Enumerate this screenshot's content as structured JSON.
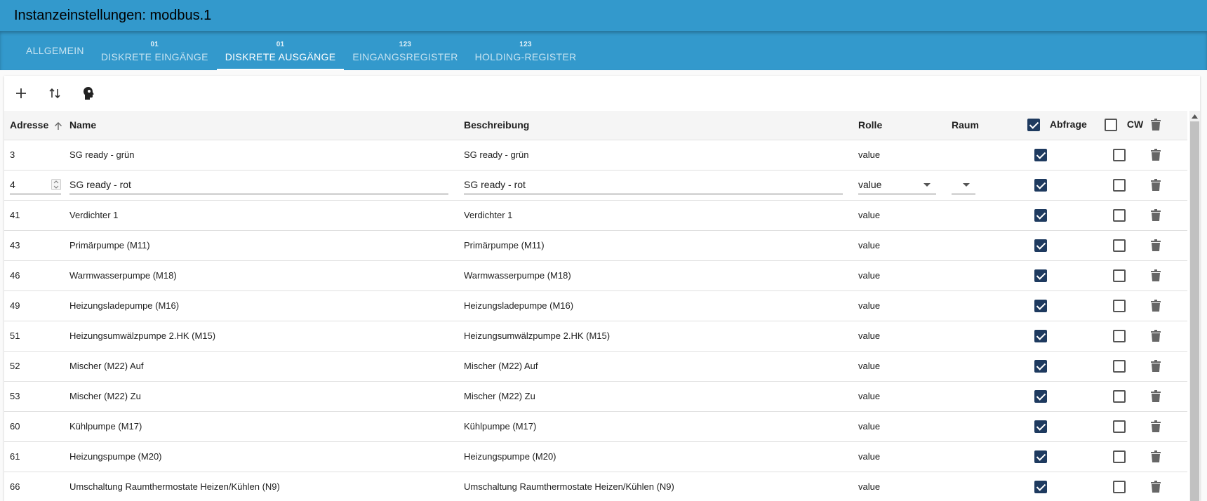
{
  "header": {
    "title": "Instanzeinstellungen: modbus.1"
  },
  "tabs": [
    {
      "label": "ALLGEMEIN",
      "badge": ""
    },
    {
      "label": "DISKRETE EINGÄNGE",
      "badge": "01"
    },
    {
      "label": "DISKRETE AUSGÄNGE",
      "badge": "01"
    },
    {
      "label": "EINGANGSREGISTER",
      "badge": "123"
    },
    {
      "label": "HOLDING-REGISTER",
      "badge": "123"
    }
  ],
  "active_tab": "DISKRETE AUSGÄNGE",
  "table": {
    "columns": {
      "adresse": "Adresse",
      "name": "Name",
      "beschreibung": "Beschreibung",
      "rolle": "Rolle",
      "raum": "Raum",
      "abfrage": "Abfrage",
      "cw": "CW"
    },
    "edit_row": {
      "adresse": "4",
      "name": "SG ready - rot",
      "beschreibung": "SG ready - rot",
      "rolle": "value",
      "raum": ""
    },
    "rows": [
      {
        "adresse": "3",
        "name": "SG ready - grün",
        "beschreibung": "SG ready - grün",
        "rolle": "value"
      },
      {
        "adresse": "41",
        "name": "Verdichter 1",
        "beschreibung": "Verdichter 1",
        "rolle": "value"
      },
      {
        "adresse": "43",
        "name": "Primärpumpe (M11)",
        "beschreibung": "Primärpumpe (M11)",
        "rolle": "value"
      },
      {
        "adresse": "46",
        "name": "Warmwasserpumpe (M18)",
        "beschreibung": "Warmwasserpumpe (M18)",
        "rolle": "value"
      },
      {
        "adresse": "49",
        "name": "Heizungsladepumpe (M16)",
        "beschreibung": "Heizungsladepumpe (M16)",
        "rolle": "value"
      },
      {
        "adresse": "51",
        "name": "Heizungsumwälzpumpe 2.HK (M15)",
        "beschreibung": "Heizungsumwälzpumpe 2.HK (M15)",
        "rolle": "value"
      },
      {
        "adresse": "52",
        "name": "Mischer (M22) Auf",
        "beschreibung": "Mischer (M22) Auf",
        "rolle": "value"
      },
      {
        "adresse": "53",
        "name": "Mischer (M22) Zu",
        "beschreibung": "Mischer (M22) Zu",
        "rolle": "value"
      },
      {
        "adresse": "60",
        "name": "Kühlpumpe (M17)",
        "beschreibung": "Kühlpumpe (M17)",
        "rolle": "value"
      },
      {
        "adresse": "61",
        "name": "Heizungspumpe (M20)",
        "beschreibung": "Heizungspumpe (M20)",
        "rolle": "value"
      },
      {
        "adresse": "66",
        "name": "Umschaltung Raumthermostate Heizen/Kühlen (N9)",
        "beschreibung": "Umschaltung Raumthermostate Heizen/Kühlen (N9)",
        "rolle": "value"
      }
    ]
  },
  "colors": {
    "header_bg": "#3399cc",
    "checkbox_checked": "#1e3a5f"
  },
  "icons": {
    "add": "plus-icon",
    "sort": "sort-icon",
    "import": "head-icon",
    "delete": "trash-icon",
    "sort_asc": "arrow-up-icon"
  }
}
